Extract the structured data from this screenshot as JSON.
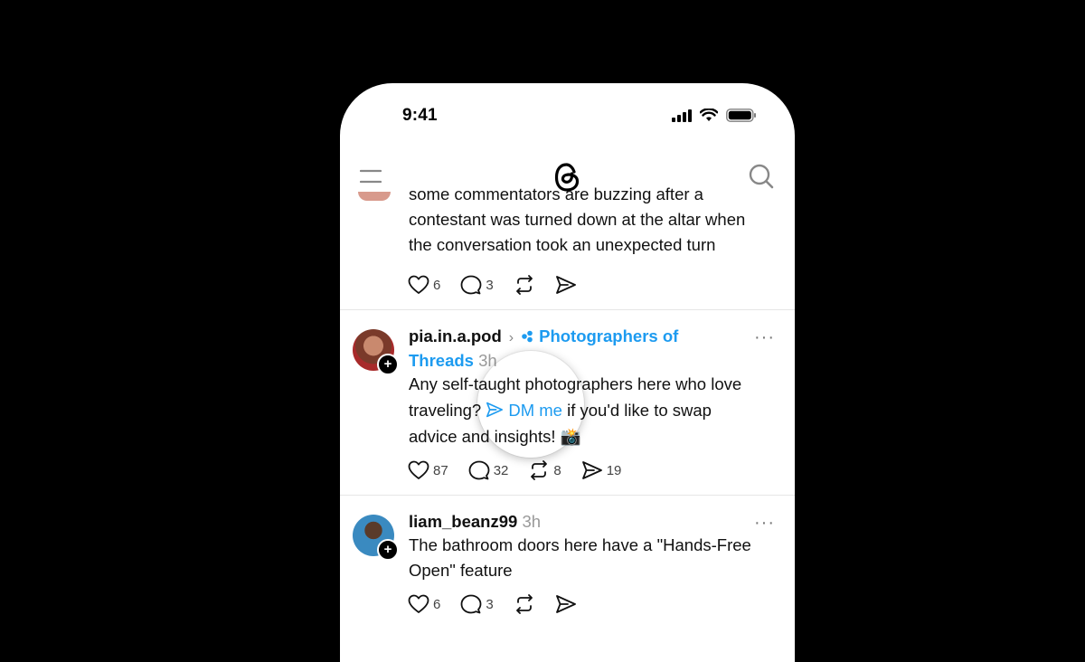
{
  "status_bar": {
    "time": "9:41"
  },
  "nav": {
    "menu_icon": "hamburger-icon",
    "logo_icon": "threads-logo-icon",
    "search_icon": "search-icon"
  },
  "posts": [
    {
      "text_lines": [
        "some commentators are buzzing after a",
        "contestant was turned down at the altar when",
        "the conversation took an unexpected turn"
      ],
      "likes": "6",
      "replies": "3"
    },
    {
      "username": "pia.in.a.pod",
      "community_line1": "Photographers of",
      "community_line2": "Threads",
      "time": "3h",
      "line1": "Any self-taught photographers here who love",
      "line2_pre": "traveling? ",
      "dm_label": "DM me",
      "line2_post": " if you'd like to swap",
      "line3": "advice and insights! 📸",
      "likes": "87",
      "replies": "32",
      "reposts": "8",
      "shares": "19"
    },
    {
      "username": "liam_beanz99",
      "time": "3h",
      "line1": "The bathroom doors here have a \"Hands-Free",
      "line2": "Open\" feature",
      "likes": "6",
      "replies": "3"
    }
  ],
  "colors": {
    "accent": "#1d9bf0",
    "text": "#111111",
    "muted": "#999999",
    "background": "#000000"
  }
}
